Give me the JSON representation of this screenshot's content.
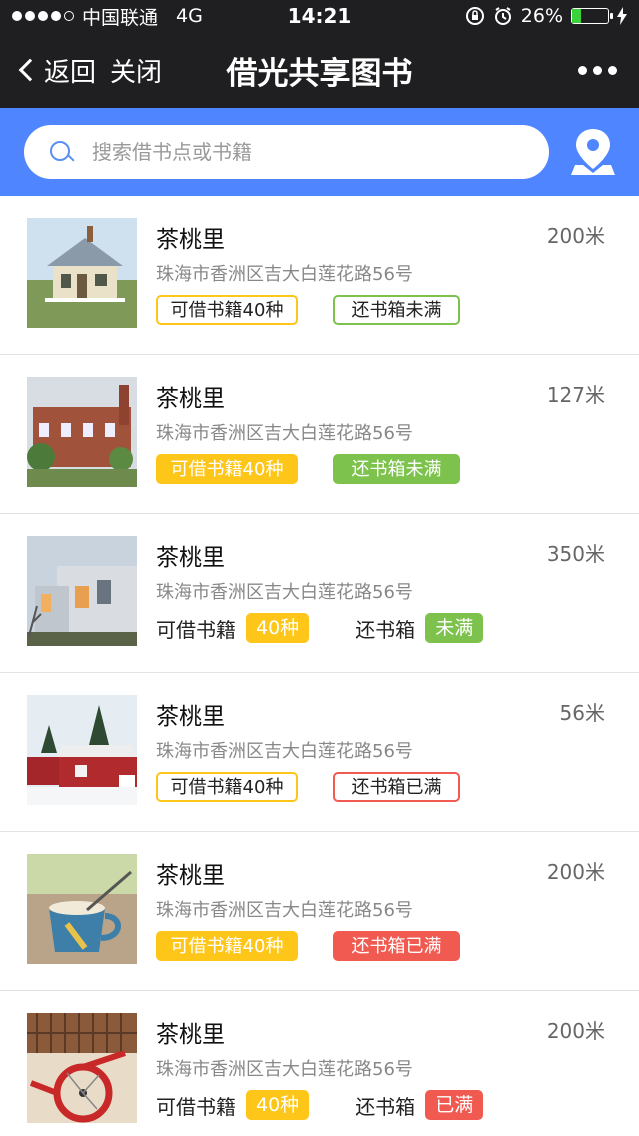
{
  "status_bar": {
    "carrier": "中国联通",
    "network": "4G",
    "time": "14:21",
    "battery": "26%",
    "battery_level": 0.26
  },
  "nav": {
    "back_label": "返回",
    "close_label": "关闭",
    "title": "借光共享图书"
  },
  "search": {
    "placeholder": "搜索借书点或书籍"
  },
  "colors": {
    "nav_bg": "#1f1f22",
    "search_bg": "#4f86ff",
    "yellow": "#ffc61a",
    "green": "#7cc24c",
    "red": "#f05a50"
  },
  "items": [
    {
      "name": "茶桃里",
      "distance": "200米",
      "address": "珠海市香洲区吉大白莲花路56号",
      "tag1": "可借书籍40种",
      "tag2": "还书箱未满",
      "style": "outline",
      "tag2_color": "green",
      "thumb": "cottage"
    },
    {
      "name": "茶桃里",
      "distance": "127米",
      "address": "珠海市香洲区吉大白莲花路56号",
      "tag1": "可借书籍40种",
      "tag2": "还书箱未满",
      "style": "filled",
      "tag2_color": "green",
      "thumb": "brick-house"
    },
    {
      "name": "茶桃里",
      "distance": "350米",
      "address": "珠海市香洲区吉大白莲花路56号",
      "label1": "可借书籍",
      "value1": "40种",
      "label2": "还书箱",
      "value2": "未满",
      "style": "split",
      "tag2_color": "green",
      "thumb": "modern-building"
    },
    {
      "name": "茶桃里",
      "distance": "56米",
      "address": "珠海市香洲区吉大白莲花路56号",
      "tag1": "可借书籍40种",
      "tag2": "还书箱已满",
      "style": "outline",
      "tag2_color": "red",
      "thumb": "red-cabin"
    },
    {
      "name": "茶桃里",
      "distance": "200米",
      "address": "珠海市香洲区吉大白莲花路56号",
      "tag1": "可借书籍40种",
      "tag2": "还书箱已满",
      "style": "filled",
      "tag2_color": "red",
      "thumb": "coffee-cup"
    },
    {
      "name": "茶桃里",
      "distance": "200米",
      "address": "珠海市香洲区吉大白莲花路56号",
      "label1": "可借书籍",
      "value1": "40种",
      "label2": "还书箱",
      "value2": "已满",
      "style": "split",
      "tag2_color": "red",
      "thumb": "red-bicycle"
    }
  ]
}
